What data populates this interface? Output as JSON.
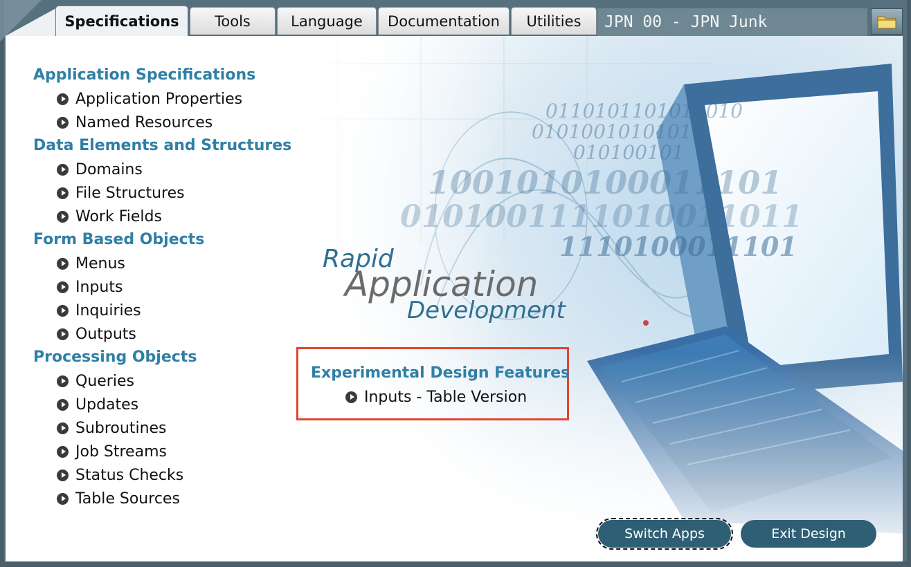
{
  "tabs": [
    {
      "label": "Specifications",
      "active": true
    },
    {
      "label": "Tools",
      "active": false
    },
    {
      "label": "Language",
      "active": false
    },
    {
      "label": "Documentation",
      "active": false
    },
    {
      "label": "Utilities",
      "active": false
    }
  ],
  "app_title": "JPN 00 - JPN Junk",
  "sections": [
    {
      "title": "Application Specifications",
      "items": [
        "Application Properties",
        "Named Resources"
      ]
    },
    {
      "title": "Data Elements and Structures",
      "items": [
        "Domains",
        "File Structures",
        "Work Fields"
      ]
    },
    {
      "title": "Form Based Objects",
      "items": [
        "Menus",
        "Inputs",
        "Inquiries",
        "Outputs"
      ]
    },
    {
      "title": "Processing Objects",
      "items": [
        "Queries",
        "Updates",
        "Subroutines",
        "Job Streams",
        "Status Checks",
        "Table Sources"
      ]
    }
  ],
  "experimental": {
    "title": "Experimental Design Features",
    "items": [
      "Inputs - Table Version"
    ],
    "highlight_color": "#e0462e"
  },
  "hero": {
    "line1": "Rapid",
    "line2": "Application",
    "line3": "Development",
    "binary": [
      "0110101101010010",
      "01010010101010",
      "010100101",
      "1001010100011101",
      "0101001111010011011",
      "1110100011101"
    ]
  },
  "buttons": {
    "switch_apps": "Switch Apps",
    "exit_design": "Exit Design"
  },
  "icons": {
    "bullet": "arrow-circle-icon",
    "folder": "folder-icon"
  },
  "colors": {
    "section_title": "#2f7fa6",
    "button": "#2f5f74",
    "title_bar": "#6f8793"
  }
}
